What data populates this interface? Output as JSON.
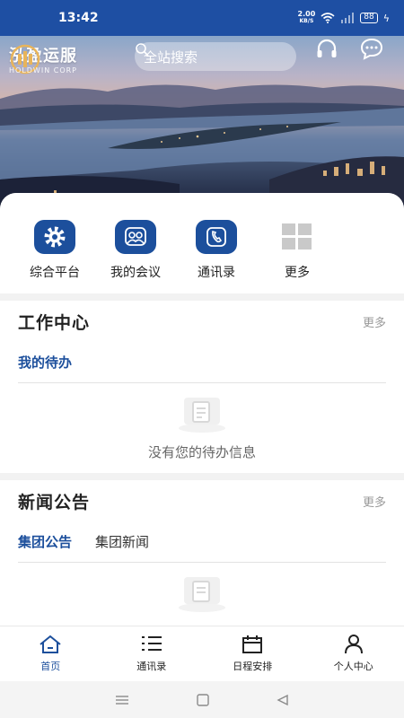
{
  "status_bar": {
    "time": "13:42",
    "net_speed_value": "2.00",
    "net_speed_unit": "KB/S",
    "battery": "88"
  },
  "header": {
    "logo_cn": "泓盈运服",
    "logo_en": "HOLDWIN CORP",
    "search_placeholder": "全站搜索"
  },
  "quick_actions": [
    {
      "label": "综合平台",
      "icon": "gear-icon"
    },
    {
      "label": "我的会议",
      "icon": "meeting-icon"
    },
    {
      "label": "通讯录",
      "icon": "phone-book-icon"
    },
    {
      "label": "更多",
      "icon": "grid-icon"
    }
  ],
  "work_center": {
    "title": "工作中心",
    "more": "更多",
    "tabs": [
      "我的待办"
    ],
    "empty_text": "没有您的待办信息"
  },
  "news": {
    "title": "新闻公告",
    "more": "更多",
    "tabs": [
      "集团公告",
      "集团新闻"
    ]
  },
  "bottom_nav": [
    {
      "label": "首页",
      "icon": "home-icon"
    },
    {
      "label": "通讯录",
      "icon": "list-icon"
    },
    {
      "label": "日程安排",
      "icon": "calendar-icon"
    },
    {
      "label": "个人中心",
      "icon": "user-icon"
    }
  ],
  "colors": {
    "primary": "#1c4f9c",
    "status_bar": "#1e4fa3"
  }
}
